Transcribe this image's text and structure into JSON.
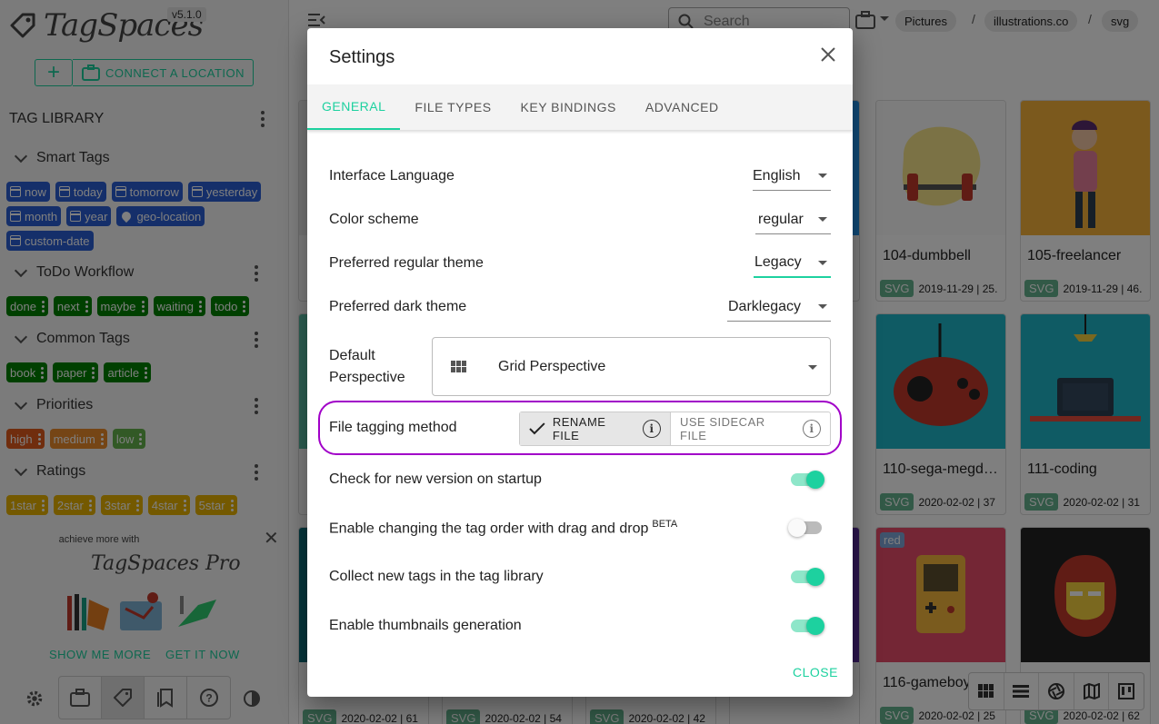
{
  "app": {
    "logo_text": "TagSpaces",
    "version": "v5.1.0",
    "connect_label": "CONNECT A LOCATION"
  },
  "sidebar": {
    "library_title": "TAG LIBRARY",
    "groups": [
      {
        "title": "Smart Tags"
      },
      {
        "title": "ToDo Workflow"
      },
      {
        "title": "Common Tags"
      },
      {
        "title": "Priorities"
      },
      {
        "title": "Ratings"
      }
    ],
    "smart_tags": [
      "now",
      "today",
      "tomorrow",
      "yesterday",
      "month",
      "year",
      "geo-location",
      "custom-date"
    ],
    "todo_tags": [
      "done",
      "next",
      "maybe",
      "waiting",
      "todo"
    ],
    "common_tags": [
      "book",
      "paper",
      "article"
    ],
    "priority_tags": [
      "high",
      "medium",
      "low"
    ],
    "rating_tags": [
      "1star",
      "2star",
      "3star",
      "4star",
      "5star"
    ],
    "promo": {
      "line": "achieve more with",
      "logo": "TagSpaces Pro",
      "show_more": "SHOW ME MORE",
      "get_it": "GET IT NOW"
    }
  },
  "main": {
    "search_placeholder": "Search",
    "breadcrumbs": [
      "Pictures",
      "illustrations.co",
      "svg"
    ],
    "cards": [
      {
        "name": "104-dumbbell",
        "ext": "SVG",
        "meta": "2019-11-29 | 25."
      },
      {
        "name": "105-freelancer",
        "ext": "SVG",
        "meta": "2019-11-29 | 46."
      },
      {
        "name": "110-sega-megd…",
        "ext": "SVG",
        "meta": "2020-02-02 | 37"
      },
      {
        "name": "111-coding",
        "ext": "SVG",
        "meta": "2020-02-02 | 31"
      },
      {
        "name": "116-gameboy",
        "ext": "SVG",
        "meta": "2020-02-02 | 25",
        "tag": "red"
      },
      {
        "name": "",
        "ext": "SVG",
        "meta": "2020-02-02 | 62"
      }
    ],
    "bottom_metas": [
      "2020-02-02 | 61",
      "2020-02-02 | 54",
      "2020-02-02 | 42"
    ]
  },
  "dialog": {
    "title": "Settings",
    "tabs": [
      "GENERAL",
      "FILE TYPES",
      "KEY BINDINGS",
      "ADVANCED"
    ],
    "interface_language": {
      "label": "Interface Language",
      "value": "English"
    },
    "color_scheme": {
      "label": "Color scheme",
      "value": "regular"
    },
    "regular_theme": {
      "label": "Preferred regular theme",
      "value": "Legacy"
    },
    "dark_theme": {
      "label": "Preferred dark theme",
      "value": "Darklegacy"
    },
    "default_perspective": {
      "label_line1": "Default",
      "label_line2": "Perspective",
      "value": "Grid Perspective"
    },
    "tagging_method": {
      "label": "File tagging method",
      "option_rename": "RENAME FILE",
      "option_sidecar": "USE SIDECAR FILE",
      "info_glyph": "i"
    },
    "check_version": {
      "label": "Check for new version on startup",
      "enabled": true
    },
    "tag_order_drag": {
      "label": "Enable changing the tag order with drag and drop",
      "badge": "BETA",
      "enabled": false
    },
    "collect_tags": {
      "label": "Collect new tags in the tag library",
      "enabled": true
    },
    "thumbnails": {
      "label": "Enable thumbnails generation",
      "enabled": true
    },
    "close_label": "CLOSE"
  },
  "colors": {
    "accent": "#1dd19f",
    "smart_tag": "#2b5fd4",
    "todo_tag": "#008000",
    "high_tag": "#e05a1c",
    "medium_tag": "#eb8a2a",
    "low_tag": "#64b24c",
    "rating_tag": "#e8b300",
    "highlight": "#a100c8"
  }
}
